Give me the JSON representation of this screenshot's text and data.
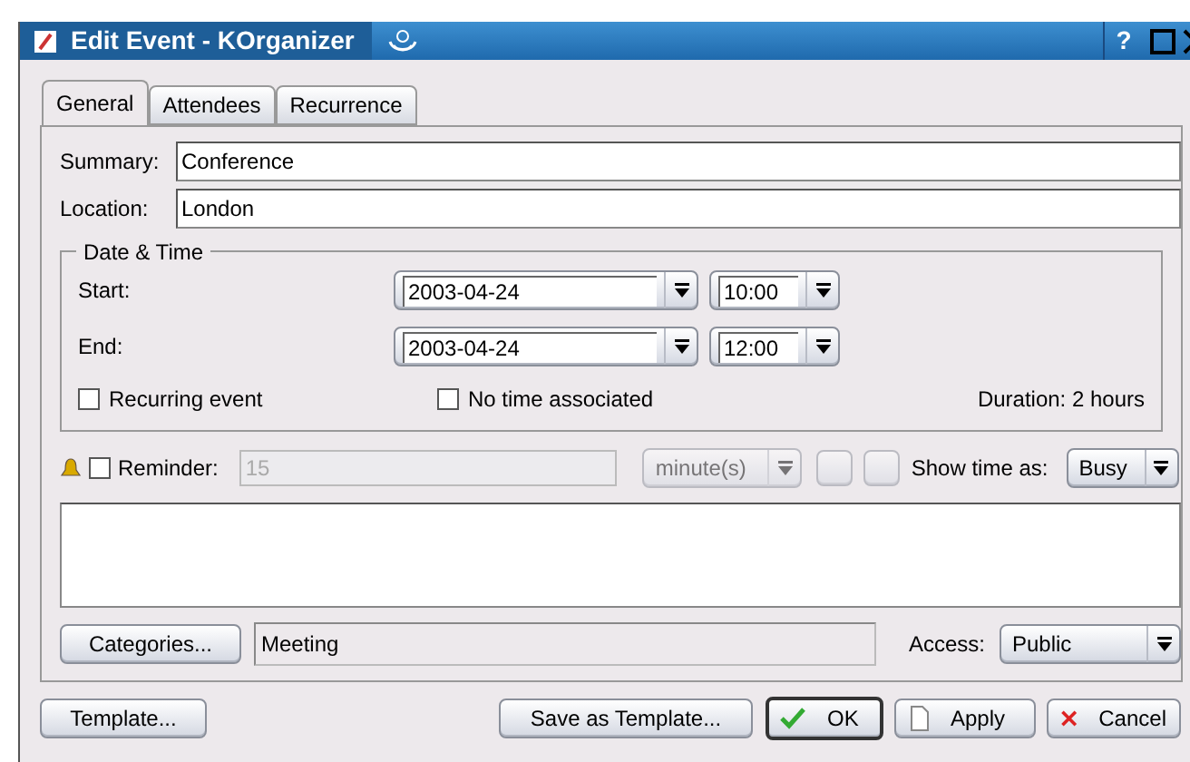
{
  "window": {
    "title": "Edit Event - KOrganizer",
    "buttons": [
      "?"
    ]
  },
  "tabs": [
    {
      "label": "General",
      "selected": true
    },
    {
      "label": "Attendees",
      "selected": false
    },
    {
      "label": "Recurrence",
      "selected": false
    }
  ],
  "summary": {
    "label": "Summary:",
    "value": "Conference"
  },
  "location": {
    "label": "Location:",
    "value": "London"
  },
  "date_time": {
    "title": "Date & Time",
    "rows": [
      {
        "label": "Start:",
        "date": "2003-04-24",
        "time": "10:00"
      },
      {
        "label": "End:",
        "date": "2003-04-24",
        "time": "12:00"
      }
    ],
    "recurring": {
      "label": "Recurring event",
      "checked": false
    },
    "no_time": {
      "label": "No time associated",
      "checked": false
    },
    "duration": "Duration: 2 hours"
  },
  "reminder": {
    "label": "Reminder:",
    "checked": false,
    "value": "15",
    "unit": "minute(s)",
    "disabled": true
  },
  "show_time_as": {
    "label": "Show time as:",
    "value": "Busy"
  },
  "categories": {
    "button": "Categories...",
    "value": "Meeting"
  },
  "access": {
    "label": "Access:",
    "value": "Public"
  },
  "footer": {
    "template": "Template...",
    "save_template": "Save as Template...",
    "ok": "OK",
    "apply": "Apply",
    "cancel": "Cancel"
  }
}
